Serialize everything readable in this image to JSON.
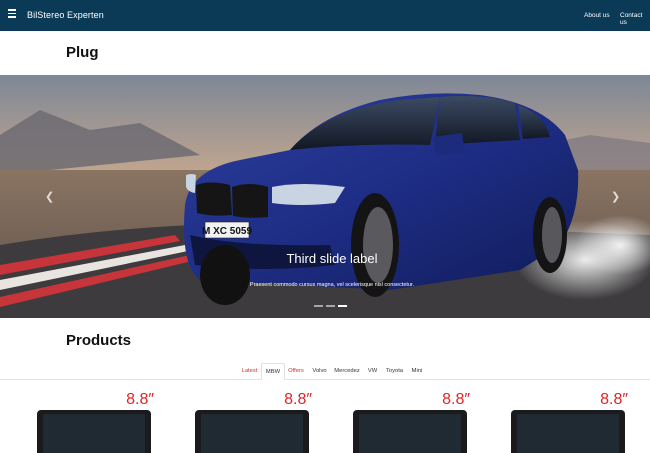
{
  "navbar": {
    "brand": "BilStereo Experten",
    "links": [
      "About us",
      "Contact us"
    ],
    "background": "#0b3a57"
  },
  "plug_section": {
    "title": "Plug"
  },
  "carousel": {
    "active_slide": 3,
    "slide_count": 3,
    "caption_title": "Third slide label",
    "caption_text": "Praesent commodo cursus magna, vel scelerisque nisl consectetur.",
    "license_plate": "M XC 5059",
    "prev_icon": "chevron-left-icon",
    "next_icon": "chevron-right-icon"
  },
  "products_section": {
    "title": "Products",
    "tabs": [
      {
        "label": "Latest",
        "color": "#d1342f"
      },
      {
        "label": "MBW",
        "active": true
      },
      {
        "label": "Offers",
        "color": "#d1342f"
      },
      {
        "label": "Volvo"
      },
      {
        "label": "Mercedez"
      },
      {
        "label": "VW"
      },
      {
        "label": "Toyota"
      },
      {
        "label": "Mini"
      }
    ],
    "cards": [
      {
        "size": "8.8″"
      },
      {
        "size": "8.8″"
      },
      {
        "size": "8.8″"
      },
      {
        "size": "8.8″"
      }
    ]
  }
}
